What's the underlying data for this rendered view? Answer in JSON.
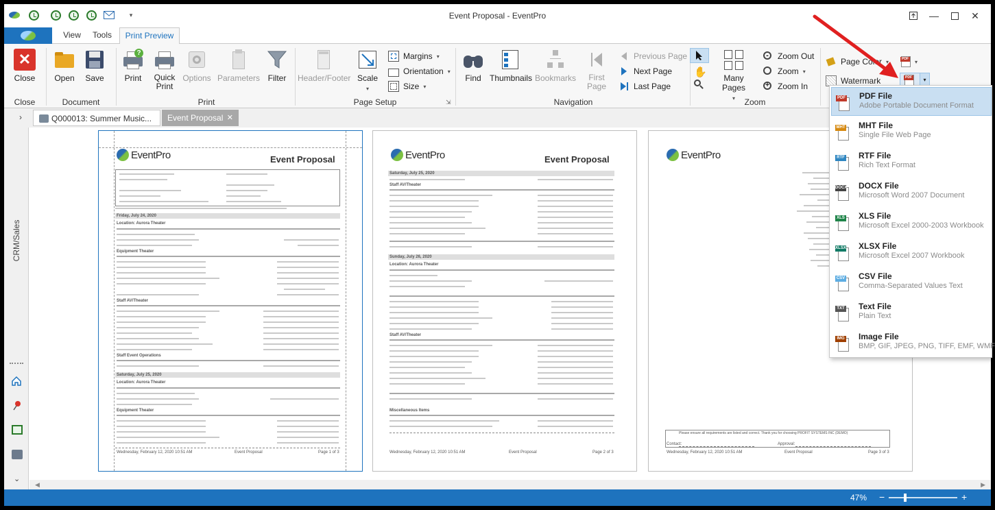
{
  "window": {
    "title": "Event Proposal - EventPro"
  },
  "tabs": {
    "view": "View",
    "tools": "Tools",
    "print_preview": "Print Preview"
  },
  "ribbon": {
    "close_group": {
      "label": "Close",
      "close": "Close"
    },
    "document_group": {
      "label": "Document",
      "open": "Open",
      "save": "Save"
    },
    "print_group": {
      "label": "Print",
      "print": "Print",
      "quick_print_1": "Quick",
      "quick_print_2": "Print",
      "options": "Options",
      "parameters": "Parameters",
      "filter": "Filter"
    },
    "page_setup_group": {
      "label": "Page Setup",
      "header_footer": "Header/Footer",
      "scale": "Scale",
      "margins": "Margins",
      "orientation": "Orientation",
      "size": "Size"
    },
    "navigation_group": {
      "label": "Navigation",
      "find": "Find",
      "thumbnails": "Thumbnails",
      "bookmarks": "Bookmarks",
      "first_page_1": "First",
      "first_page_2": "Page",
      "previous_page": "Previous Page",
      "next_page": "Next Page",
      "last_page": "Last Page"
    },
    "zoom_group": {
      "label": "Zoom",
      "many_pages": "Many Pages",
      "zoom_out": "Zoom Out",
      "zoom": "Zoom",
      "zoom_in": "Zoom In"
    },
    "background_group": {
      "page_color": "Page Color",
      "watermark": "Watermark",
      "pdf_badge": "PDF"
    }
  },
  "doc_tabs": [
    {
      "label": "Q000013: Summer Music..."
    },
    {
      "label": "Event Proposal"
    }
  ],
  "sidebar": {
    "module": "CRM/Sales"
  },
  "preview": {
    "doc_title": "Event Proposal",
    "logo_text": "EventPro",
    "page1": {
      "date1": "Friday, July 24, 2020",
      "date2": "Saturday, July 25, 2020",
      "location": "Location: Aurora Theater",
      "equipment": "Equipment Theater",
      "staff": "Staff AV/Theater",
      "staff_ops": "Staff Event Operations",
      "footer_left": "Wednesday, February 12, 2020 10:51 AM",
      "footer_mid": "Event Proposal",
      "footer_right": "Page 1 of 3"
    },
    "page2": {
      "date1": "Saturday, July 25, 2020",
      "date2": "Sunday, July 26, 2020",
      "staff": "Staff AV/Theater",
      "location": "Location: Aurora Theater",
      "misc": "Miscellaneous Items",
      "footer_left": "Wednesday, February 12, 2020 10:51 AM",
      "footer_mid": "Event Proposal",
      "footer_right": "Page 2 of 3"
    },
    "page3": {
      "notice": "Please ensure all requirements are listed and correct.  Thank you for choosing PROFIT SYSTEMS INC (DEMO)",
      "contact": "Contact:",
      "approval": "Approval:",
      "footer_left": "Wednesday, February 12, 2020 10:51 AM",
      "footer_mid": "Event Proposal",
      "footer_right": "Page 3 of 3"
    }
  },
  "export_menu": [
    {
      "badge": "PDF",
      "color": "#c0392b",
      "title": "PDF File",
      "subtitle": "Adobe Portable Document Format"
    },
    {
      "badge": "MHT",
      "color": "#d68910",
      "title": "MHT File",
      "subtitle": "Single File Web Page"
    },
    {
      "badge": "RTF",
      "color": "#2e86c1",
      "title": "RTF File",
      "subtitle": "Rich Text Format"
    },
    {
      "badge": "DOCX",
      "color": "#444444",
      "title": "DOCX File",
      "subtitle": "Microsoft Word 2007 Document"
    },
    {
      "badge": "XLS",
      "color": "#1e8449",
      "title": "XLS File",
      "subtitle": "Microsoft Excel 2000-2003 Workbook"
    },
    {
      "badge": "XLSX",
      "color": "#117a65",
      "title": "XLSX File",
      "subtitle": "Microsoft Excel 2007 Workbook"
    },
    {
      "badge": "CSV",
      "color": "#5dade2",
      "title": "CSV File",
      "subtitle": "Comma-Separated Values Text"
    },
    {
      "badge": "TXT",
      "color": "#555555",
      "title": "Text File",
      "subtitle": "Plain Text"
    },
    {
      "badge": "IMG",
      "color": "#a04000",
      "title": "Image File",
      "subtitle": "BMP, GIF, JPEG, PNG, TIFF, EMF, WMF"
    }
  ],
  "status": {
    "zoom_level": "47%",
    "zoom_fraction": 0.47
  },
  "colors": {
    "accent": "#1e73be",
    "annotation_arrow": "#e02020"
  }
}
